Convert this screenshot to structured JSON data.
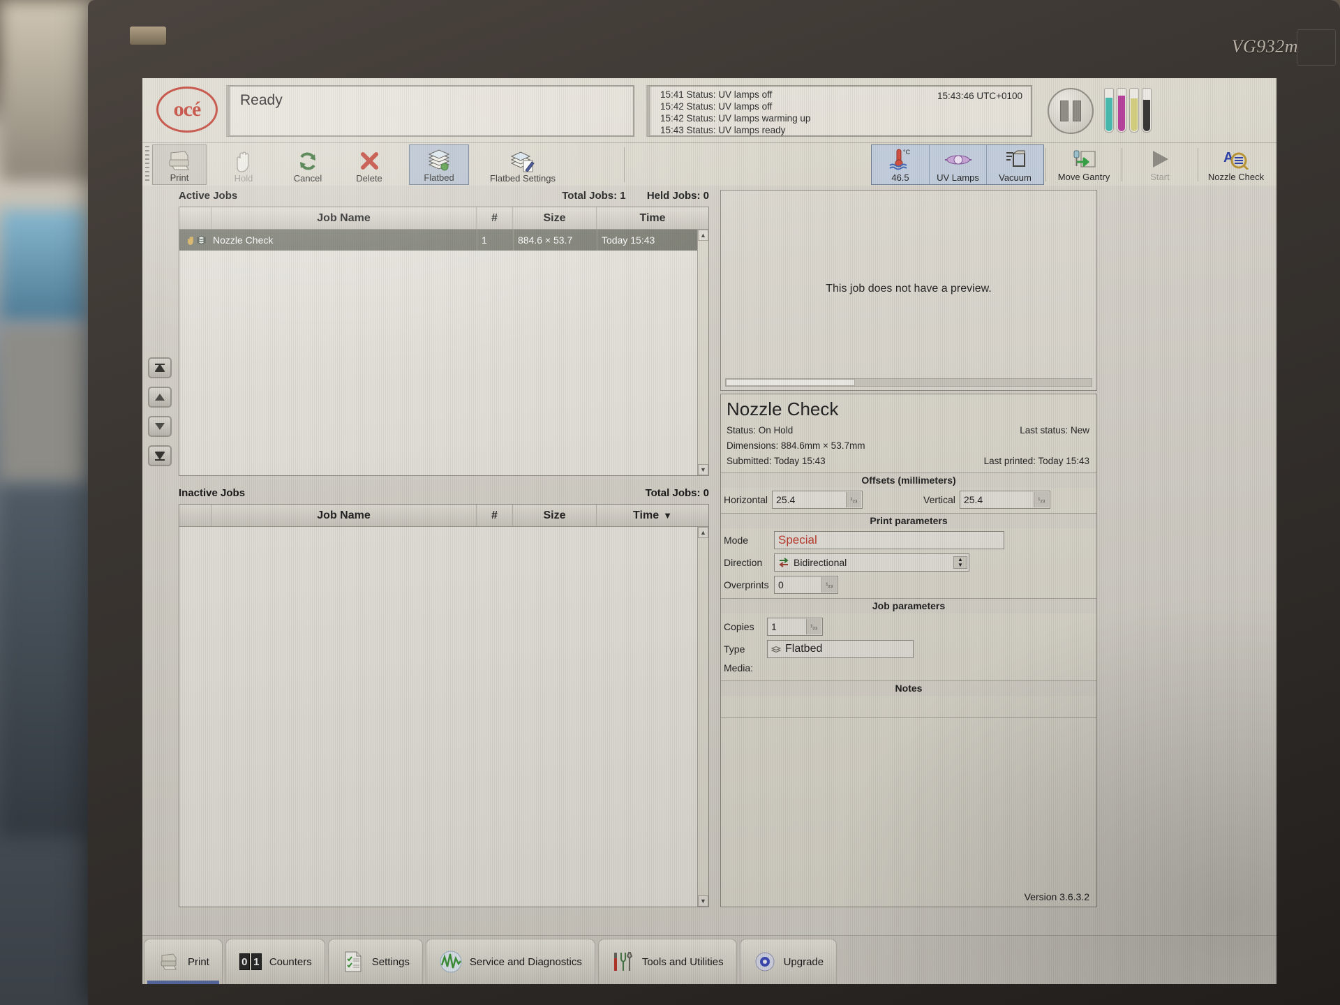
{
  "monitor": {
    "brand_model": "VG932m"
  },
  "header": {
    "logo_text": "océ",
    "status": "Ready",
    "clock": "15:43:46 UTC+0100",
    "log": [
      "15:41 Status: UV lamps off",
      "15:42 Status: UV lamps off",
      "15:42 Status: UV lamps warming up",
      "15:43 Status: UV lamps ready"
    ],
    "pause_button": "Pause",
    "ink_levels": [
      {
        "name": "cyan",
        "color": "#3fb9ab",
        "fill_pct": 78
      },
      {
        "name": "magenta",
        "color": "#b5399a",
        "fill_pct": 82
      },
      {
        "name": "yellow",
        "color": "#d4cf7a",
        "fill_pct": 76
      },
      {
        "name": "black",
        "color": "#2f2e2c",
        "fill_pct": 72
      }
    ]
  },
  "toolbar": {
    "left": [
      {
        "label": "Print",
        "icon": "printer-icon",
        "state": "pressed"
      },
      {
        "label": "Hold",
        "icon": "hand-icon",
        "state": "disabled"
      },
      {
        "label": "Cancel",
        "icon": "refresh-icon",
        "state": "normal"
      },
      {
        "label": "Delete",
        "icon": "x-icon",
        "state": "normal"
      },
      {
        "label": "Flatbed",
        "icon": "stack-icon",
        "state": "selected"
      },
      {
        "label": "Flatbed Settings",
        "icon": "stack-pencil-icon",
        "state": "normal"
      }
    ],
    "right": {
      "group": [
        {
          "label": "46.5",
          "sublabel": "°C",
          "icon": "thermometer-icon"
        },
        {
          "label": "UV Lamps",
          "icon": "uv-lamp-icon"
        },
        {
          "label": "Vacuum",
          "icon": "vacuum-icon"
        }
      ],
      "plain": [
        {
          "label": "Move Gantry",
          "icon": "move-gantry-icon",
          "state": "normal"
        },
        {
          "label": "Start",
          "icon": "play-icon",
          "state": "disabled"
        },
        {
          "label": "Nozzle Check",
          "icon": "nozzle-check-icon",
          "state": "normal"
        }
      ]
    }
  },
  "queue_nav": [
    {
      "name": "move-to-top-button"
    },
    {
      "name": "move-up-button"
    },
    {
      "name": "move-down-button"
    },
    {
      "name": "move-to-bottom-button"
    }
  ],
  "active_jobs": {
    "title": "Active Jobs",
    "total_label": "Total Jobs: 1",
    "held_label": "Held Jobs: 0",
    "columns": [
      "",
      "Job Name",
      "#",
      "Size",
      "Time"
    ],
    "rows": [
      {
        "name": "Nozzle Check",
        "count": "1",
        "size": "884.6 × 53.7",
        "time": "Today 15:43",
        "selected": true
      }
    ]
  },
  "inactive_jobs": {
    "title": "Inactive Jobs",
    "total_label": "Total Jobs: 0",
    "columns": [
      "",
      "Job Name",
      "#",
      "Size",
      "Time"
    ],
    "sort_column": "Time",
    "sort_glyph": "▼",
    "rows": []
  },
  "preview": {
    "message": "This job does not have a preview."
  },
  "details": {
    "job_title": "Nozzle Check",
    "status_label": "Status: On Hold",
    "last_status_label": "Last status: New",
    "dimensions_label": "Dimensions: 884.6mm × 53.7mm",
    "submitted_label": "Submitted:  Today 15:43",
    "last_printed_label": "Last printed:  Today 15:43",
    "offsets_title": "Offsets (millimeters)",
    "horizontal_label": "Horizontal",
    "horizontal_value": "25.4",
    "vertical_label": "Vertical",
    "vertical_value": "25.4",
    "print_params_title": "Print parameters",
    "mode_label": "Mode",
    "mode_value": "Special",
    "mode_color": "#c0392b",
    "direction_label": "Direction",
    "direction_value": "Bidirectional",
    "overprints_label": "Overprints",
    "overprints_value": "0",
    "job_params_title": "Job parameters",
    "copies_label": "Copies",
    "copies_value": "1",
    "type_label": "Type",
    "type_value": "Flatbed",
    "media_label": "Media:",
    "media_value": "",
    "notes_title": "Notes",
    "notes_value": "",
    "version": "Version 3.6.3.2"
  },
  "taskbar": [
    {
      "label": "Print",
      "icon": "printer-icon",
      "active": true
    },
    {
      "label": "Counters",
      "icon": "counters-icon",
      "active": false
    },
    {
      "label": "Settings",
      "icon": "checklist-icon",
      "active": false
    },
    {
      "label": "Service and Diagnostics",
      "icon": "waveform-icon",
      "active": false
    },
    {
      "label": "Tools and Utilities",
      "icon": "tools-icon",
      "active": false
    },
    {
      "label": "Upgrade",
      "icon": "disc-icon",
      "active": false
    }
  ]
}
